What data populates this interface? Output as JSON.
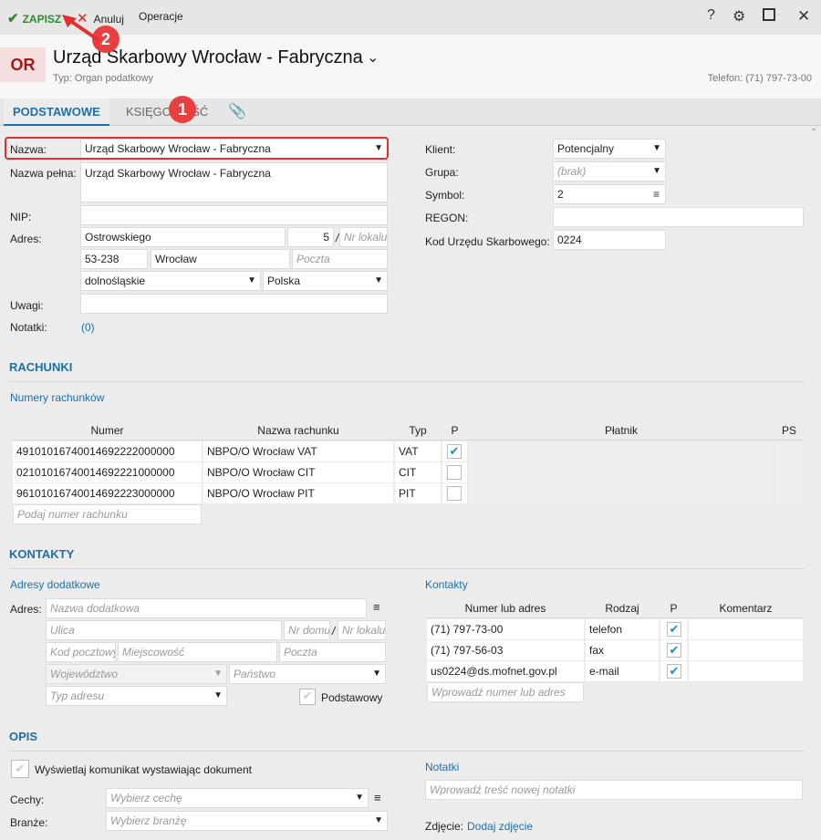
{
  "toolbar": {
    "save": "ZAPISZ",
    "cancel": "Anuluj",
    "operations": "Operacje"
  },
  "header": {
    "badge": "OR",
    "title": "Urząd Skarbowy Wrocław - Fabryczna",
    "type_label": "Typ: Organ podatkowy",
    "phone": "Telefon: (71) 797-73-00"
  },
  "tabs": [
    "PODSTAWOWE",
    "KSIĘGOWOŚĆ"
  ],
  "markers": [
    "1",
    "2"
  ],
  "form": {
    "name_label": "Nazwa:",
    "name_value": "Urząd Skarbowy Wrocław - Fabryczna",
    "fullname_label": "Nazwa pełna:",
    "fullname_value": "Urząd Skarbowy Wrocław - Fabryczna",
    "nip_label": "NIP:",
    "address_label": "Adres:",
    "street": "Ostrowskiego",
    "house_no": "5",
    "slash": "/",
    "flat_placeholder": "Nr lokalu",
    "postcode": "53-238",
    "city": "Wrocław",
    "post_placeholder": "Poczta",
    "region": "dolnośląskie",
    "country": "Polska",
    "remarks_label": "Uwagi:",
    "notes_label": "Notatki:",
    "notes_count": "(0)"
  },
  "right_form": {
    "client_label": "Klient:",
    "client_value": "Potencjalny",
    "group_label": "Grupa:",
    "group_value": "(brak)",
    "symbol_label": "Symbol:",
    "symbol_value": "2",
    "regon_label": "REGON:",
    "tax_office_label": "Kod Urzędu Skarbowego:",
    "tax_office_value": "0224"
  },
  "accounts": {
    "section": "RACHUNKI",
    "subtitle": "Numery rachunków",
    "headers": [
      "Numer",
      "Nazwa rachunku",
      "Typ",
      "P",
      "Płatnik",
      "PS"
    ],
    "rows": [
      {
        "number": "49101016740014692222000000",
        "name": "NBPO/O Wrocław VAT",
        "type": "VAT",
        "p": true
      },
      {
        "number": "02101016740014692221000000",
        "name": "NBPO/O Wrocław CIT",
        "type": "CIT",
        "p": false
      },
      {
        "number": "96101016740014692223000000",
        "name": "NBPO/O Wrocław PIT",
        "type": "PIT",
        "p": false
      }
    ],
    "new_placeholder": "Podaj numer rachunku"
  },
  "contacts": {
    "section": "KONTAKTY",
    "addresses_title": "Adresy dodatkowe",
    "addr_label": "Adres:",
    "ph_name": "Nazwa dodatkowa",
    "ph_street": "Ulica",
    "ph_house": "Nr domu",
    "ph_flat": "Nr lokalu",
    "ph_postcode": "Kod pocztowy",
    "ph_city": "Miejscowość",
    "ph_post": "Poczta",
    "ph_region": "Województwo",
    "ph_country": "Państwo",
    "ph_type": "Typ adresu",
    "primary_label": "Podstawowy",
    "contacts_title": "Kontakty",
    "headers": [
      "Numer lub adres",
      "Rodzaj",
      "P",
      "Komentarz"
    ],
    "rows": [
      {
        "value": "(71) 797-73-00",
        "kind": "telefon",
        "p": true
      },
      {
        "value": "(71) 797-56-03",
        "kind": "fax",
        "p": true
      },
      {
        "value": "us0224@ds.mofnet.gov.pl",
        "kind": "e-mail",
        "p": true
      }
    ],
    "new_placeholder": "Wprowadź numer lub adres"
  },
  "description": {
    "section": "OPIS",
    "show_msg_label": "Wyświetlaj komunikat wystawiając dokument",
    "features_label": "Cechy:",
    "features_ph": "Wybierz cechę",
    "industries_label": "Branże:",
    "industries_ph": "Wybierz branżę",
    "notes_title": "Notatki",
    "notes_ph": "Wprowadź treść nowej notatki",
    "photo_label": "Zdjęcie:",
    "photo_link": "Dodaj zdjęcie"
  }
}
